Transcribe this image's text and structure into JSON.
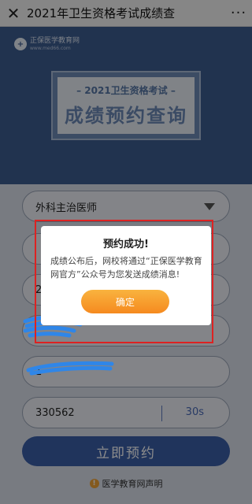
{
  "topbar": {
    "title": "2021年卫生资格考试成绩查",
    "more": "···"
  },
  "brand": {
    "name": "正保医学教育网",
    "url": "www.med66.com"
  },
  "banner": {
    "year_title": "– 2021卫生资格考试 –",
    "main_title": "成绩预约查询"
  },
  "form": {
    "exam_type": "外科主治医师",
    "field3_partial": "2",
    "phone_masked": "1",
    "verify_code": "330562",
    "countdown": "30s",
    "submit_label": "立即预约",
    "disclaimer": "医学教育网声明"
  },
  "dialog": {
    "title": "预约成功!",
    "message": "成绩公布后，网校将通过“正保医学教育网官方”公众号为您发送成绩消息!",
    "confirm_label": "确定"
  },
  "colors": {
    "header_bg": "#3d5d91",
    "submit_bg": "#3b5fa8",
    "confirm_bg": "#f58a1f",
    "annotation": "#d22222",
    "scribble": "#2f86e8"
  }
}
